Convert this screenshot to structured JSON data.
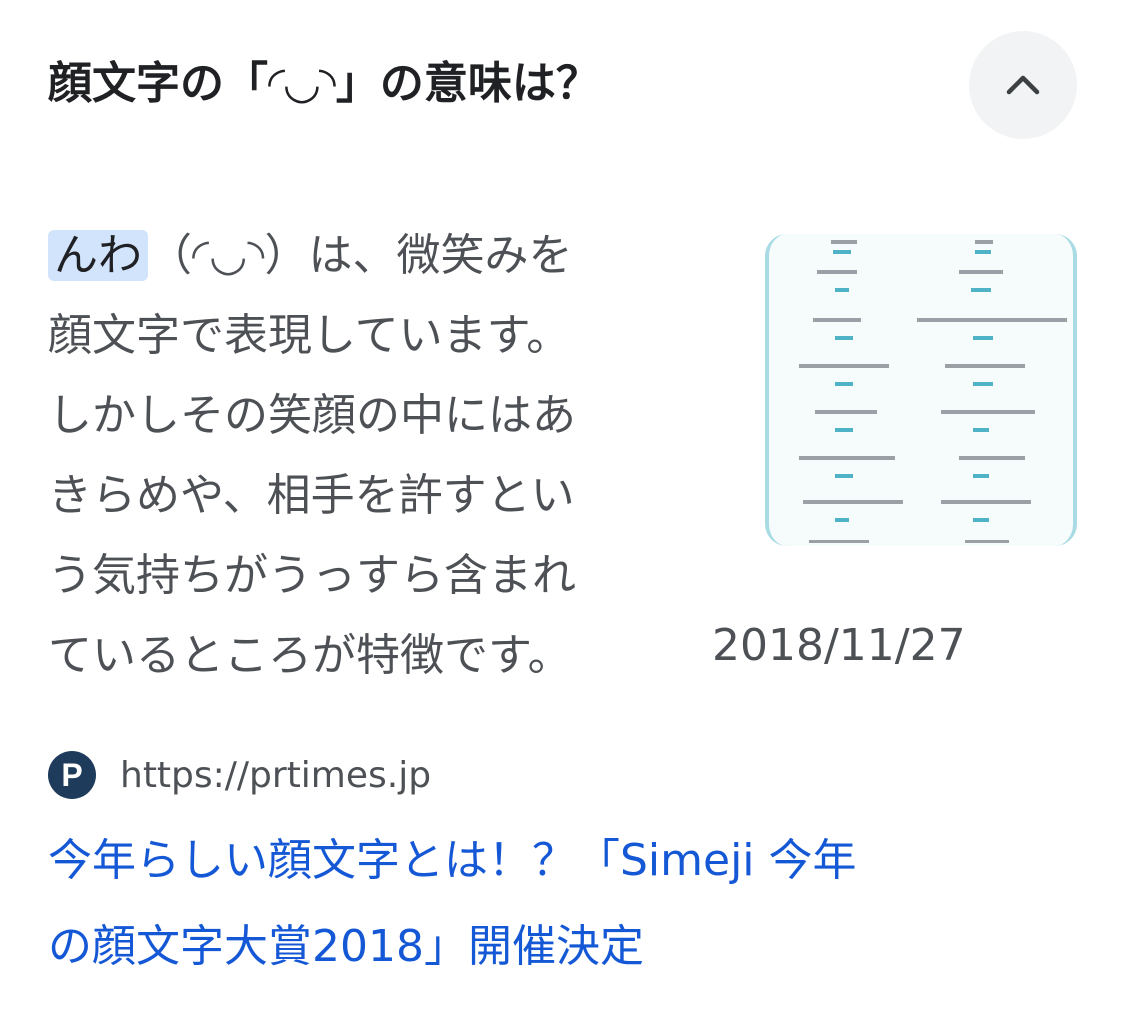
{
  "question": {
    "text": "顔文字の「◜◡◝」の意味は？"
  },
  "collapse_icon": "chevron-up-icon",
  "answer": {
    "highlight": "んわ",
    "body": "（◜◡◝）は、微笑みを\n顔文字で表現しています。\nしかしその笑顔の中にはあ\nきらめや、相手を許すとい\nう気持ちがうっすら含まれ\nているところが特徴です。",
    "date": "2018/11/27"
  },
  "source": {
    "favicon_letter": "P",
    "url": "https://prtimes.jp"
  },
  "result": {
    "title": "今年らしい顔文字とは！？「Simeji 今年\nの顔文字大賞2018」開催決定"
  },
  "colors": {
    "link": "#1558d6",
    "highlight_bg": "#d2e3fc",
    "button_bg": "#f1f3f4",
    "favicon_bg": "#1f3b5b"
  }
}
